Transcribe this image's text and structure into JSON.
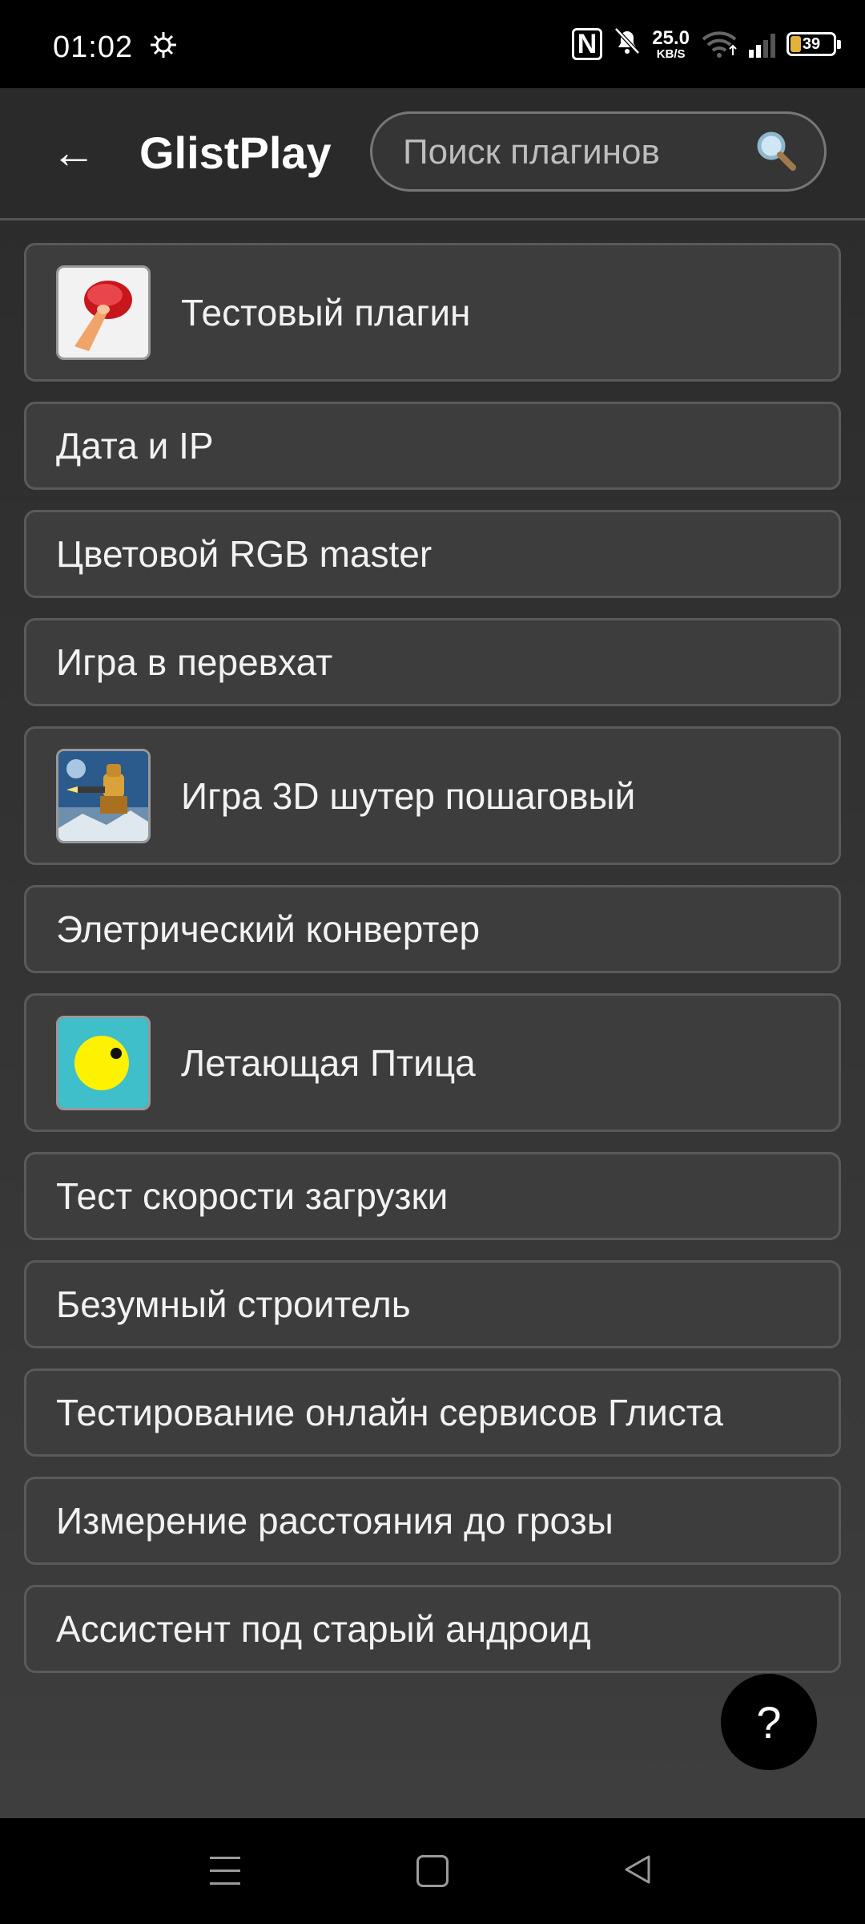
{
  "status_bar": {
    "time": "01:02",
    "nfc": "N",
    "speed_value": "25.0",
    "speed_unit": "KB/S",
    "battery_level": "39",
    "icons": [
      "bluetooth-gear-icon",
      "nfc-icon",
      "bell-off-icon",
      "wifi-icon",
      "signal-icon",
      "battery-icon"
    ]
  },
  "app_bar": {
    "back_icon": "←",
    "title": "GlistPlay",
    "search_placeholder": "Поиск плагинов",
    "search_icon": "search-icon"
  },
  "plugins": [
    {
      "label": "Тестовый плагин",
      "icon": "finger-button-icon"
    },
    {
      "label": "Дата и IP"
    },
    {
      "label": "Цветовой RGB master"
    },
    {
      "label": "Игра в перевхат"
    },
    {
      "label": "Игра 3D шутер пошаговый",
      "icon": "robot-shooter-icon"
    },
    {
      "label": "Элетрический конвертер"
    },
    {
      "label": "Летающая Птица",
      "icon": "yellow-bird-icon"
    },
    {
      "label": "Тест скорости загрузки"
    },
    {
      "label": "Безумный строитель"
    },
    {
      "label": "Тестирование онлайн сервисов Глиста"
    },
    {
      "label": "Измерение расстояния до грозы"
    },
    {
      "label": "Ассистент под старый андроид"
    }
  ],
  "fab": {
    "label": "?"
  },
  "colors": {
    "background": "#333333",
    "card": "#3d3d3d",
    "card_border": "#5a5a5a",
    "bird_bg": "#3fbfc9",
    "bird_body": "#fff200",
    "battery_fill": "#e3b23c"
  },
  "nav_bar": {
    "icons": [
      "recents-menu-icon",
      "home-square-icon",
      "back-triangle-icon"
    ]
  }
}
